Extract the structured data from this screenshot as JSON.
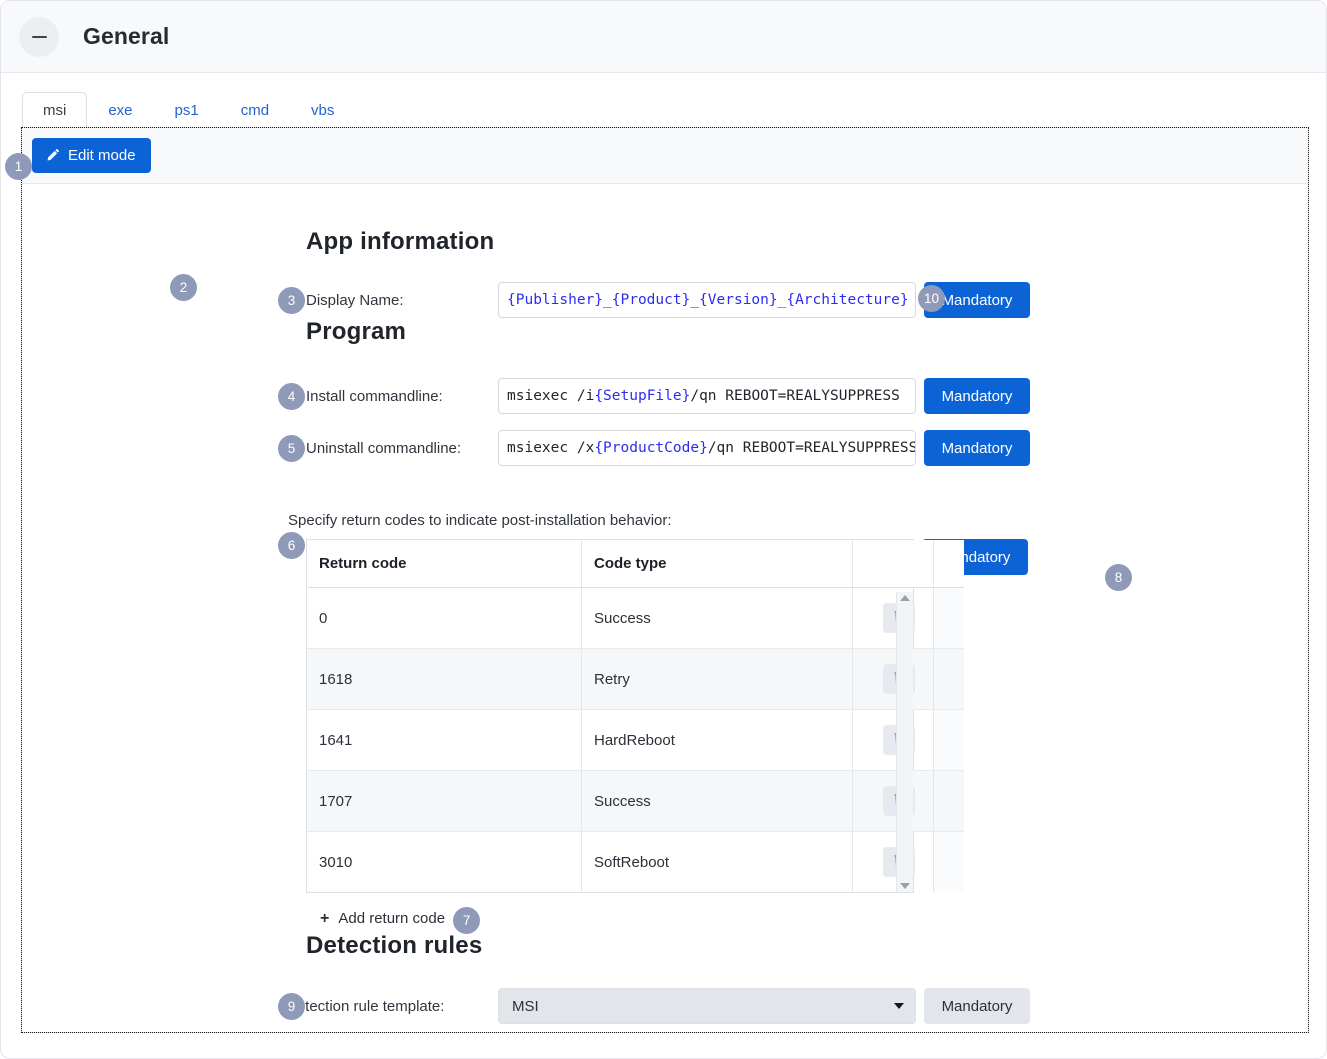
{
  "header": {
    "title": "General",
    "collapse_icon": "minus-circle-icon"
  },
  "tabs": [
    {
      "label": "msi",
      "active": true
    },
    {
      "label": "exe",
      "active": false
    },
    {
      "label": "ps1",
      "active": false
    },
    {
      "label": "cmd",
      "active": false
    },
    {
      "label": "vbs",
      "active": false
    }
  ],
  "toolbar": {
    "edit_mode_label": "Edit mode",
    "edit_mode_icon": "pencil-icon"
  },
  "sections": {
    "app_information": {
      "title": "App information",
      "display_name": {
        "label": "Display Name:",
        "value": "{Publisher}_{Product}_{Version}_{Architecture}",
        "mandatory_label": "Mandatory"
      }
    },
    "program": {
      "title": "Program",
      "install": {
        "label": "Install commandline:",
        "value_prefix": "msiexec /i ",
        "value_token": "{SetupFile}",
        "value_suffix": " /qn REBOOT=REALYSUPPRESS",
        "mandatory_label": "Mandatory"
      },
      "uninstall": {
        "label": "Uninstall commandline:",
        "value_prefix": "msiexec /x ",
        "value_token": "{ProductCode}",
        "value_suffix": " /qn REBOOT=REALYSUPPRESS",
        "mandatory_label": "Mandatory"
      },
      "return_codes": {
        "caption": "Specify return codes to indicate post-installation behavior:",
        "mandatory_label": "Mandatory",
        "columns": [
          "Return code",
          "Code type"
        ],
        "rows": [
          {
            "code": "0",
            "type": "Success"
          },
          {
            "code": "1618",
            "type": "Retry"
          },
          {
            "code": "1641",
            "type": "HardReboot"
          },
          {
            "code": "1707",
            "type": "Success"
          },
          {
            "code": "3010",
            "type": "SoftReboot"
          }
        ],
        "delete_icon": "trash-icon",
        "add_label": "Add return code",
        "add_icon": "plus-icon"
      }
    },
    "detection_rules": {
      "title": "Detection rules",
      "template": {
        "label": "Detection rule template:",
        "value": "MSI",
        "options": [
          "MSI"
        ],
        "mandatory_label": "Mandatory"
      }
    }
  },
  "callouts": {
    "c1": "1",
    "c2": "2",
    "c3": "3",
    "c4": "4",
    "c5": "5",
    "c6": "6",
    "c7": "7",
    "c8": "8",
    "c9": "9",
    "c10": "10"
  },
  "colors": {
    "primary": "#0c63d6",
    "link": "#2563d4",
    "token": "#2d2df0",
    "badge": "#8e9ab8",
    "header_bg": "#f7f9fb"
  }
}
